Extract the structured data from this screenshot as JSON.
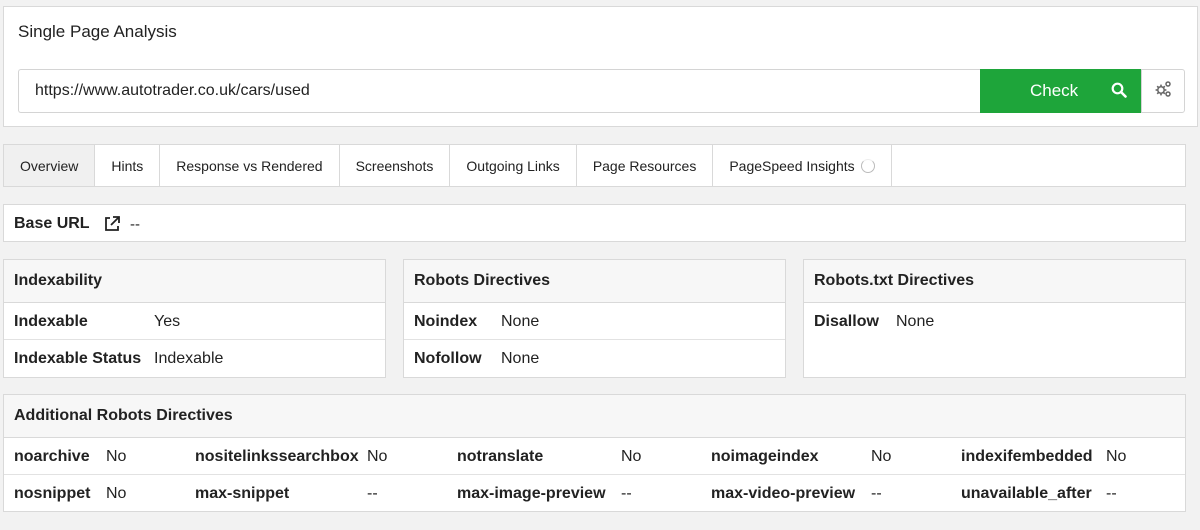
{
  "header": {
    "title": "Single Page Analysis"
  },
  "search": {
    "url": "https://www.autotrader.co.uk/cars/used",
    "check_label": "Check"
  },
  "tabs": [
    {
      "label": "Overview",
      "active": true
    },
    {
      "label": "Hints"
    },
    {
      "label": "Response vs Rendered"
    },
    {
      "label": "Screenshots"
    },
    {
      "label": "Outgoing Links"
    },
    {
      "label": "Page Resources"
    },
    {
      "label": "PageSpeed Insights"
    }
  ],
  "base_url": {
    "label": "Base URL",
    "value": "--"
  },
  "indexability": {
    "title": "Indexability",
    "rows": [
      {
        "key": "Indexable",
        "value": "Yes"
      },
      {
        "key": "Indexable Status",
        "value": "Indexable"
      }
    ]
  },
  "robots_directives": {
    "title": "Robots Directives",
    "rows": [
      {
        "key": "Noindex",
        "value": "None"
      },
      {
        "key": "Nofollow",
        "value": "None"
      }
    ]
  },
  "robots_txt": {
    "title": "Robots.txt Directives",
    "rows": [
      {
        "key": "Disallow",
        "value": "None"
      }
    ]
  },
  "additional": {
    "title": "Additional Robots Directives",
    "rows": [
      [
        {
          "key": "noarchive",
          "value": "No"
        },
        {
          "key": "nositelinkssearchbox",
          "value": "No"
        },
        {
          "key": "notranslate",
          "value": "No"
        },
        {
          "key": "noimageindex",
          "value": "No"
        },
        {
          "key": "indexifembedded",
          "value": "No"
        }
      ],
      [
        {
          "key": "nosnippet",
          "value": "No"
        },
        {
          "key": "max-snippet",
          "value": "--"
        },
        {
          "key": "max-image-preview",
          "value": "--"
        },
        {
          "key": "max-video-preview",
          "value": "--"
        },
        {
          "key": "unavailable_after",
          "value": "--"
        }
      ]
    ]
  },
  "colors": {
    "accent": "#1ea53a"
  }
}
